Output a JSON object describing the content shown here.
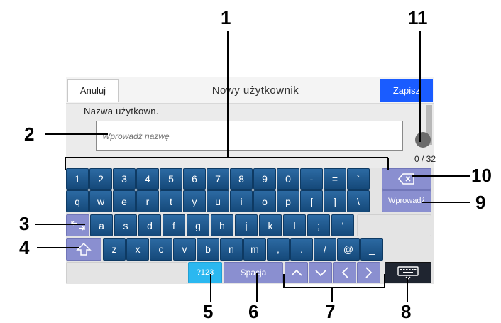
{
  "dialog": {
    "cancel_label": "Anuluj",
    "title": "Nowy użytkownik",
    "save_label": "Zapisz",
    "field_label": "Nazwa użytkown.",
    "input_placeholder": "Wprowadź nazwę",
    "input_value": "",
    "counter": "0 / 32"
  },
  "keyboard": {
    "row1": [
      "1",
      "2",
      "3",
      "4",
      "5",
      "6",
      "7",
      "8",
      "9",
      "0",
      "-",
      "=",
      "`"
    ],
    "row2": [
      "q",
      "w",
      "e",
      "r",
      "t",
      "y",
      "u",
      "i",
      "o",
      "p",
      "[",
      "]",
      "\\"
    ],
    "row3": [
      "a",
      "s",
      "d",
      "f",
      "g",
      "h",
      "j",
      "k",
      "l",
      ";",
      "'"
    ],
    "row4": [
      "z",
      "x",
      "c",
      "v",
      "b",
      "n",
      "m",
      ",",
      ".",
      "/",
      "@",
      "_"
    ],
    "enter_label": "Wprowadź",
    "symbols_label": "?123",
    "space_label": "Spacja",
    "icons": {
      "backspace": "backspace-icon",
      "tab": "tab-icon",
      "shift": "shift-icon",
      "up": "arrow-up-icon",
      "down": "arrow-down-icon",
      "left": "arrow-left-icon",
      "right": "arrow-right-icon",
      "hide": "keyboard-hide-icon"
    }
  },
  "callouts": [
    "1",
    "2",
    "3",
    "4",
    "5",
    "6",
    "7",
    "8",
    "9",
    "10",
    "11"
  ],
  "colors": {
    "key": "#1e5a91",
    "special_key": "#8a8fd0",
    "symbols_key": "#2bb8f0",
    "save_button": "#1a5cff"
  }
}
